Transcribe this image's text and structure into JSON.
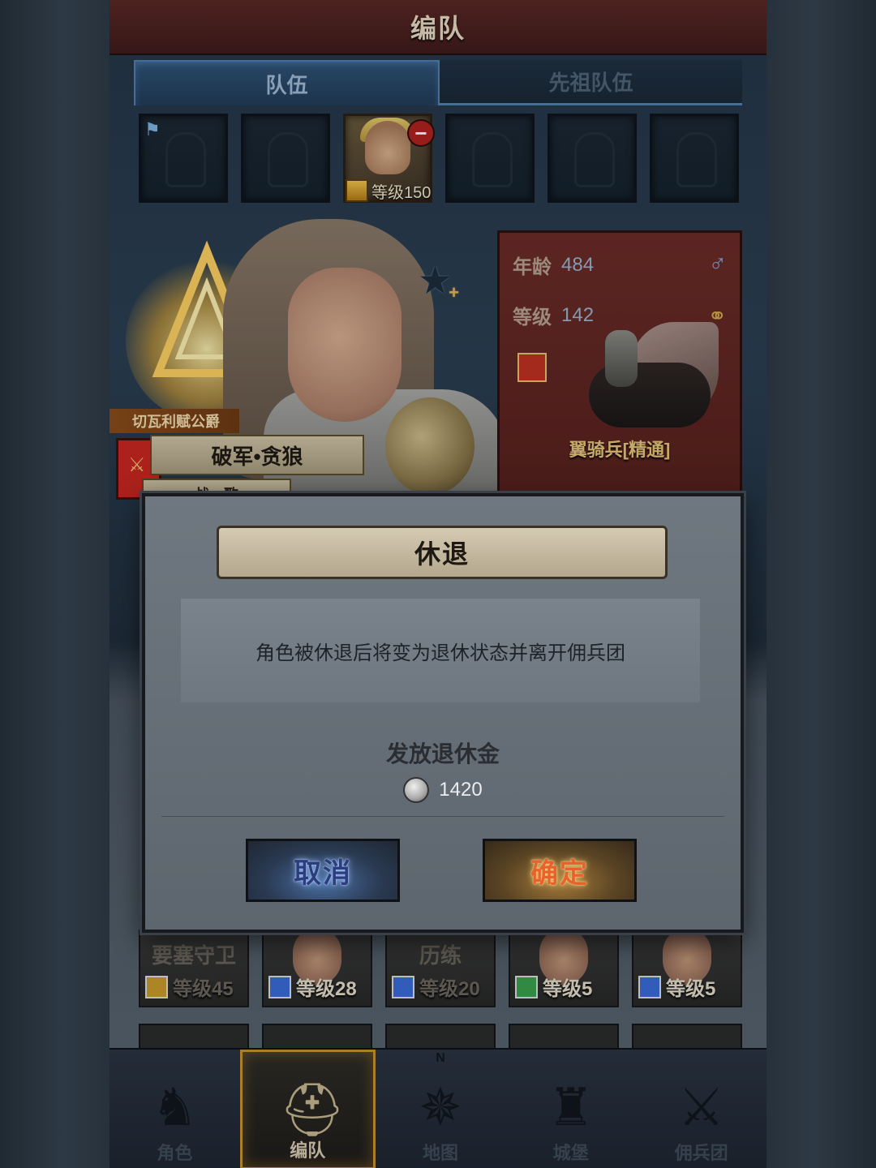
{
  "header": {
    "title": "编队"
  },
  "tabs": [
    {
      "label": "队伍",
      "active": true
    },
    {
      "label": "先祖队伍",
      "active": false
    }
  ],
  "team_slots": [
    {
      "filled": false,
      "flag": true
    },
    {
      "filled": false
    },
    {
      "filled": true,
      "level_text": "等级150"
    },
    {
      "filled": false
    },
    {
      "filled": false
    },
    {
      "filled": false
    }
  ],
  "hero": {
    "title": "切瓦利赋公爵",
    "name": "破军•贪狼",
    "tags": "战、歌"
  },
  "stats": {
    "age_label": "年龄",
    "age_value": "484",
    "level_label": "等级",
    "level_value": "142",
    "troop_name": "翼骑兵[精通]"
  },
  "dialog": {
    "title": "休退",
    "message": "角色被休退后将变为退休状态并离开佣兵团",
    "pension_label": "发放退休金",
    "pension_amount": "1420",
    "cancel_label": "取消",
    "confirm_label": "确定"
  },
  "roster": [
    {
      "title": "要塞守卫",
      "level": "等级45",
      "icon_color": "#c89a2a",
      "dim": true
    },
    {
      "title": "",
      "level": "等级28",
      "icon_color": "#3a6ad8",
      "dim": false
    },
    {
      "title": "历练",
      "level": "等级20",
      "icon_color": "#3a6ad8",
      "dim": true
    },
    {
      "title": "",
      "level": "等级5",
      "icon_color": "#3aa04a",
      "dim": false
    },
    {
      "title": "",
      "level": "等级5",
      "icon_color": "#3a6ad8",
      "dim": false
    }
  ],
  "nav": [
    {
      "label": "角色",
      "icon": "knight-icon",
      "active": false
    },
    {
      "label": "编队",
      "icon": "helmet-icon",
      "active": true
    },
    {
      "label": "地图",
      "icon": "compass-icon",
      "active": false
    },
    {
      "label": "城堡",
      "icon": "castle-icon",
      "active": false
    },
    {
      "label": "佣兵团",
      "icon": "mercenary-icon",
      "active": false
    }
  ],
  "nav_compass_letter": "N"
}
